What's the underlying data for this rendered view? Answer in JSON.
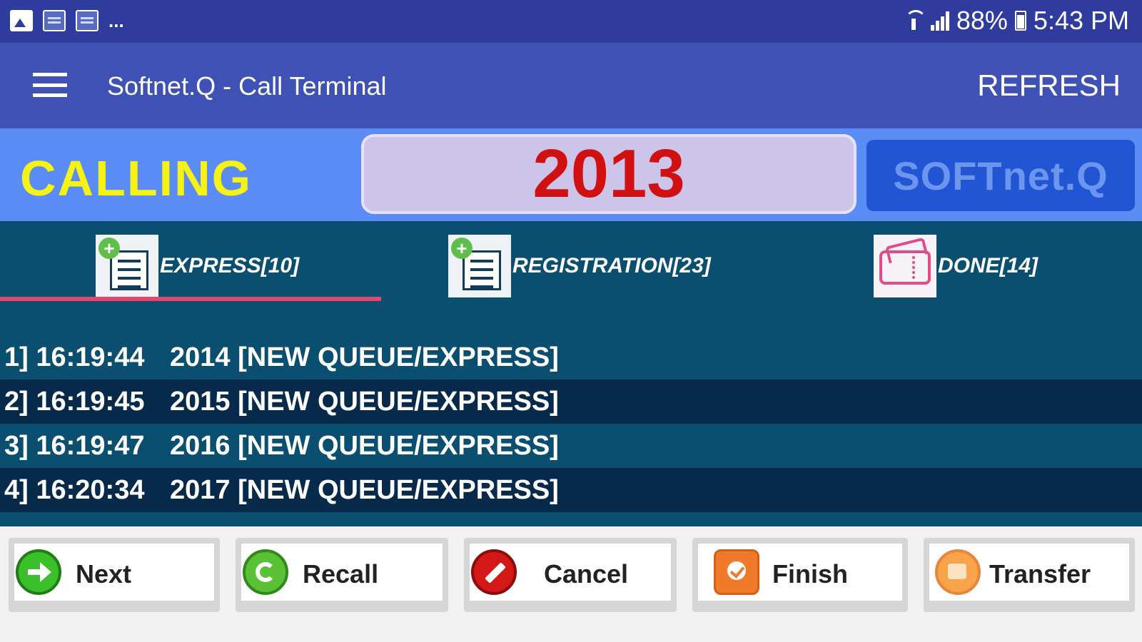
{
  "status_bar": {
    "icons": [
      "image-icon",
      "notification-icon",
      "notification-icon"
    ],
    "more": "...",
    "battery_percent": "88%",
    "time": "5:43 PM"
  },
  "app_bar": {
    "title": "Softnet.Q - Call Terminal",
    "action": "REFRESH"
  },
  "calling": {
    "label": "CALLING",
    "number": "2013",
    "brand": "SOFTnet.Q"
  },
  "tabs": [
    {
      "label": "EXPRESS[10]",
      "icon": "add-list-icon",
      "selected": true
    },
    {
      "label": "REGISTRATION[23]",
      "icon": "add-list-icon",
      "selected": false
    },
    {
      "label": "DONE[14]",
      "icon": "ticket-icon",
      "selected": false
    }
  ],
  "queue": [
    {
      "index": "1]",
      "time": "16:19:44",
      "desc": "2014 [NEW QUEUE/EXPRESS]"
    },
    {
      "index": "2]",
      "time": "16:19:45",
      "desc": "2015 [NEW QUEUE/EXPRESS]"
    },
    {
      "index": "3]",
      "time": "16:19:47",
      "desc": "2016 [NEW QUEUE/EXPRESS]"
    },
    {
      "index": "4]",
      "time": "16:20:34",
      "desc": "2017 [NEW QUEUE/EXPRESS]"
    }
  ],
  "actions": {
    "next": "Next",
    "recall": "Recall",
    "cancel": "Cancel",
    "finish": "Finish",
    "transfer": "Transfer"
  },
  "colors": {
    "status_bar": "#2f3c9e",
    "app_bar": "#3f51b5",
    "calling_bar": "#5b8bf5",
    "calling_text": "#f5f214",
    "number_text": "#d11111",
    "tabs_bg": "#0a4f6f",
    "tab_indicator": "#e8456c",
    "row_dark": "#082a4a"
  }
}
